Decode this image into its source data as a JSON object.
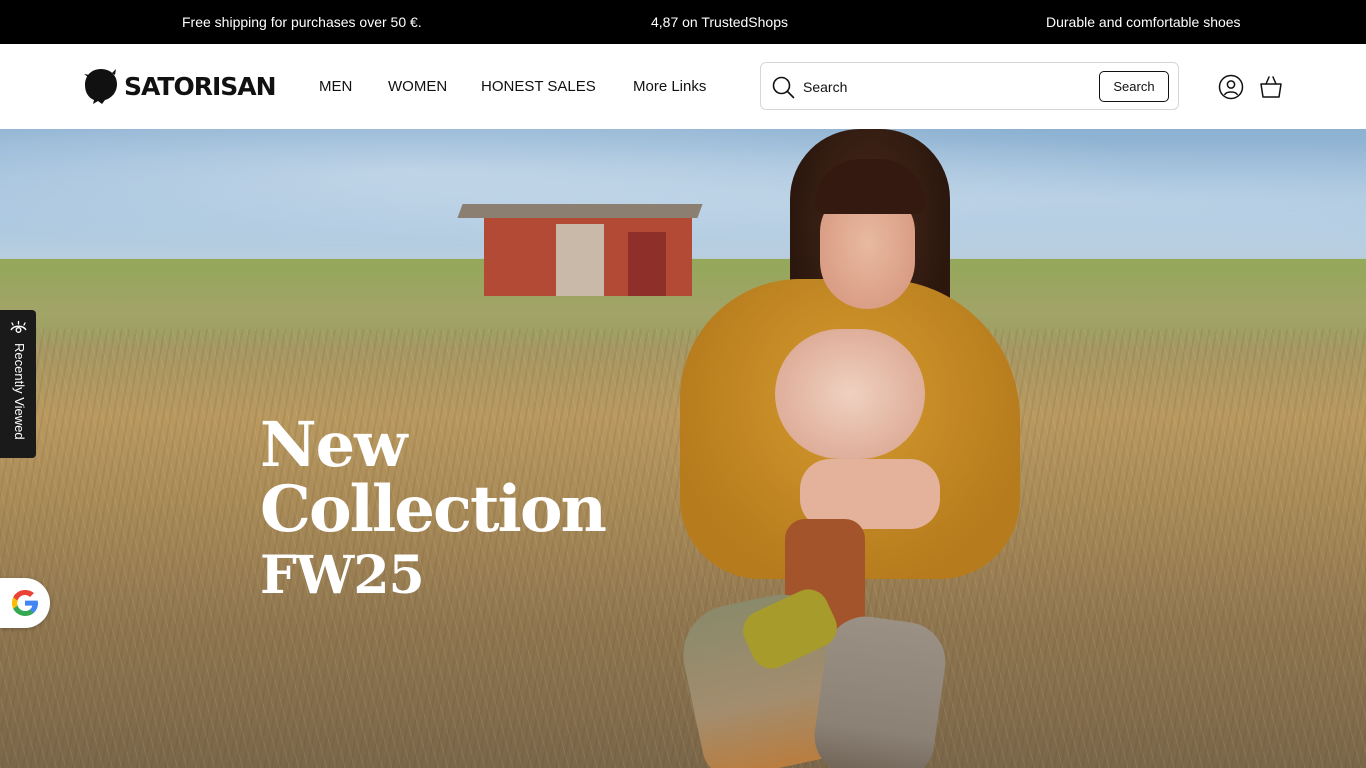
{
  "announcement": {
    "messages": [
      "Free shipping for purchases over 50 €.",
      "4,87 on TrustedShops",
      "Durable and comfortable shoes"
    ]
  },
  "header": {
    "logo_text": "SATORISAN",
    "nav": [
      "MEN",
      "WOMEN",
      "HONEST SALES",
      "More Links"
    ],
    "search": {
      "placeholder": "Search",
      "button_label": "Search"
    },
    "icons": [
      "account-icon",
      "cart-icon"
    ]
  },
  "hero": {
    "title_line1": "New",
    "title_line2": "Collection",
    "title_line3": "FW25"
  },
  "recently_viewed": {
    "label": "Recently Viewed",
    "icon": "eye-icon"
  },
  "google_badge": {
    "icon": "google-icon"
  },
  "colors": {
    "announcement_bg": "#000000",
    "header_bg": "#ffffff",
    "text": "#111111"
  }
}
